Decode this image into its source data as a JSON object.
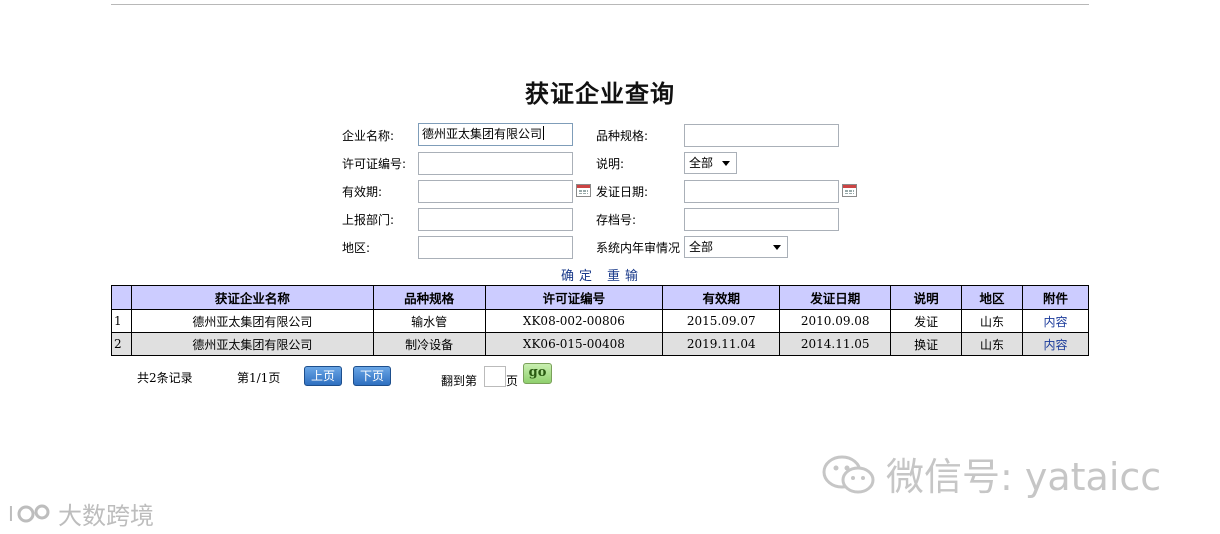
{
  "page_title": "获证企业查询",
  "form": {
    "company_name": {
      "label": "企业名称:",
      "value": "德州亚太集团有限公司"
    },
    "variety_spec": {
      "label": "品种规格:",
      "value": ""
    },
    "license_no": {
      "label": "许可证编号:",
      "value": ""
    },
    "description": {
      "label": "说明:",
      "value": "全部"
    },
    "valid_period": {
      "label": "有效期:",
      "value": ""
    },
    "issue_date": {
      "label": "发证日期:",
      "value": ""
    },
    "reporting_dept": {
      "label": "上报部门:",
      "value": ""
    },
    "archive_no": {
      "label": "存档号:",
      "value": ""
    },
    "region": {
      "label": "地区:",
      "value": ""
    },
    "annual_review": {
      "label": "系统内年审情况",
      "value": "全部"
    },
    "confirm_label": "确定",
    "reset_label": "重输"
  },
  "table": {
    "headers": [
      "",
      "获证企业名称",
      "品种规格",
      "许可证编号",
      "有效期",
      "发证日期",
      "说明",
      "地区",
      "附件"
    ],
    "rows": [
      [
        "1",
        "德州亚太集团有限公司",
        "输水管",
        "XK08-002-00806",
        "2015.09.07",
        "2010.09.08",
        "发证",
        "山东",
        "内容"
      ],
      [
        "2",
        "德州亚太集团有限公司",
        "制冷设备",
        "XK06-015-00408",
        "2019.11.04",
        "2014.11.05",
        "换证",
        "山东",
        "内容"
      ]
    ]
  },
  "pager": {
    "total_records": "共2条记录",
    "page_info": "第1/1页",
    "prev_label": "上页",
    "next_label": "下页",
    "goto_prefix": "翻到第",
    "goto_suffix": "页",
    "go_label": "go"
  },
  "watermarks": {
    "right": "微信号: yataicc",
    "left": "大数跨境"
  },
  "colors": {
    "table_header_bg": "#ccccff",
    "even_row_bg": "#e0e0e0",
    "link": "#1a3a9a",
    "pager_button": "#2e6fc0",
    "go_button": "#8fd06e"
  }
}
